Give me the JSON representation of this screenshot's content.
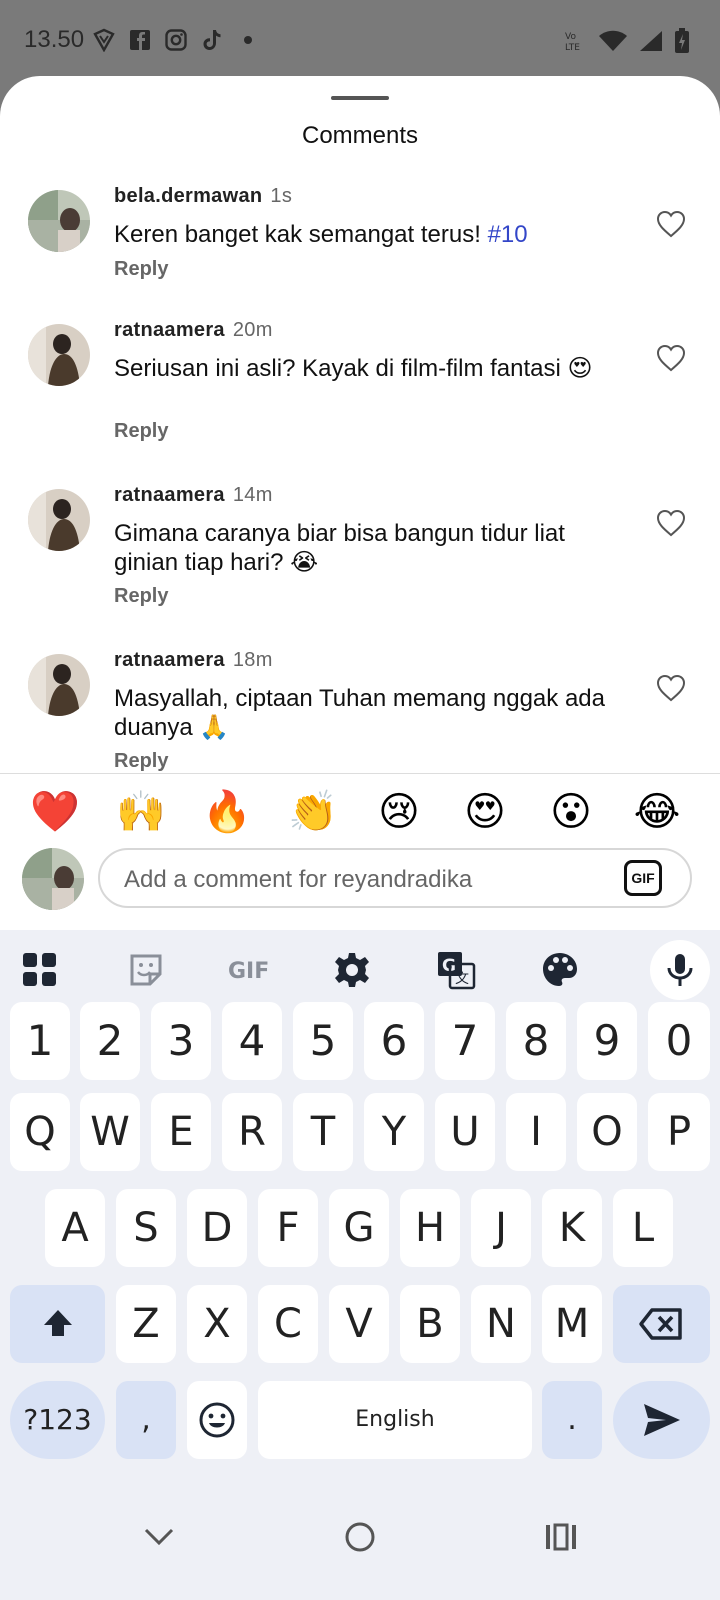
{
  "status": {
    "time": "13.50",
    "left_icons": [
      "shield-icon",
      "facebook-icon",
      "instagram-icon",
      "tiktok-icon",
      "dot-icon"
    ],
    "right_icons": [
      "volte-icon",
      "wifi-icon",
      "signal-icon",
      "battery-icon"
    ]
  },
  "sheet": {
    "title": "Comments"
  },
  "comments": [
    {
      "user": "bela.dermawan",
      "time": "1s",
      "text": "Keren banget kak semangat terus! ",
      "tag": "#10",
      "reply": "Reply"
    },
    {
      "user": "ratnaamera",
      "time": "20m",
      "text": "Seriusan ini asli? Kayak di film-film fantasi 😍",
      "reply": "Reply"
    },
    {
      "user": "ratnaamera",
      "time": "14m",
      "text": "Gimana caranya biar bisa bangun tidur liat ginian tiap hari? 😭",
      "reply": "Reply"
    },
    {
      "user": "ratnaamera",
      "time": "18m",
      "text": "Masyallah, ciptaan Tuhan memang nggak ada duanya 🙏",
      "reply": "Reply"
    }
  ],
  "emojis": [
    "❤️",
    "🙌",
    "🔥",
    "👏",
    "😢",
    "😍",
    "😮",
    "😂"
  ],
  "input": {
    "placeholder": "Add a comment for reyandradika",
    "gif_label": "GIF"
  },
  "keyboard": {
    "toolbar": {
      "gif_label": "GIF"
    },
    "row_numbers": [
      "1",
      "2",
      "3",
      "4",
      "5",
      "6",
      "7",
      "8",
      "9",
      "0"
    ],
    "row1": [
      "Q",
      "W",
      "E",
      "R",
      "T",
      "Y",
      "U",
      "I",
      "O",
      "P"
    ],
    "row2": [
      "A",
      "S",
      "D",
      "F",
      "G",
      "H",
      "J",
      "K",
      "L"
    ],
    "row3": [
      "Z",
      "X",
      "C",
      "V",
      "B",
      "N",
      "M"
    ],
    "symbols_label": "?123",
    "comma": ",",
    "space_label": "English",
    "period": "."
  },
  "colors": {
    "hashtag": "#3346c8",
    "keyboard_bg": "#eef0f6",
    "special_key": "#d9e2f5"
  }
}
